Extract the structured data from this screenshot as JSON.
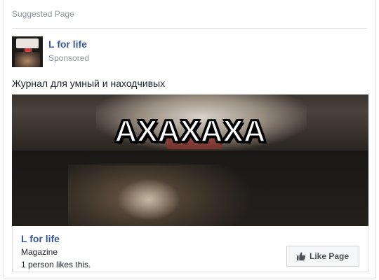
{
  "header": {
    "label": "Suggested Page"
  },
  "page": {
    "name": "L for life",
    "sponsored_label": "Sponsored"
  },
  "post": {
    "text": "Журнал для умный и находчивых"
  },
  "media": {
    "caption": "АХАХАХА"
  },
  "attachment": {
    "name": "L for life",
    "category": "Magazine",
    "likes_text": "1 person likes this.",
    "like_button_label": "Like Page",
    "like_icon": "thumbs-up-icon"
  },
  "colors": {
    "link": "#365899",
    "muted": "#90949c",
    "text": "#1d2129",
    "button_bg": "#f6f7f9",
    "button_text": "#4b4f56"
  }
}
